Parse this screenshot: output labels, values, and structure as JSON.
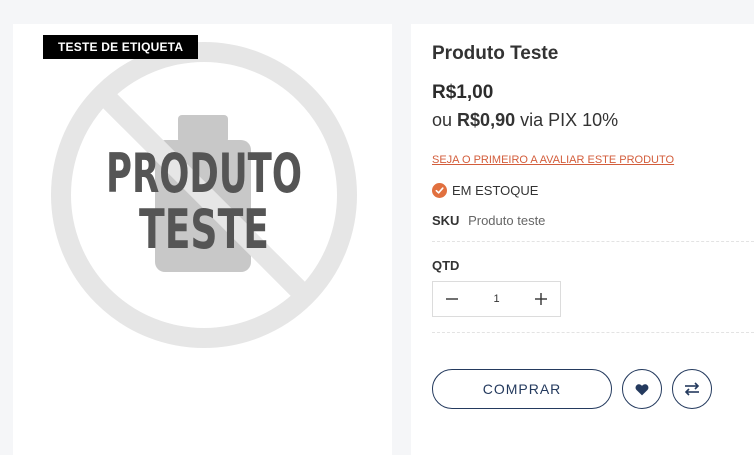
{
  "badge": {
    "label": "TESTE DE ETIQUETA"
  },
  "image": {
    "line1": "PRODUTO",
    "line2": "TESTE"
  },
  "product": {
    "title": "Produto Teste",
    "price": "R$1,00",
    "pix_prefix": "ou",
    "pix_price": "R$0,90",
    "pix_suffix": "via PIX 10%",
    "review_link": "SEJA O PRIMEIRO A AVALIAR ESTE PRODUTO",
    "stock": "EM ESTOQUE",
    "sku_label": "SKU",
    "sku_value": "Produto teste"
  },
  "quantity": {
    "label": "QTD",
    "value": "1"
  },
  "actions": {
    "buy_label": "COMPRAR"
  },
  "colors": {
    "accent": "#243a5e",
    "link": "#d35d3b",
    "stock_check": "#e1703f",
    "badge_bg": "#000000"
  },
  "icons": {
    "stock": "check-circle-icon",
    "minus": "minus-icon",
    "plus": "plus-icon",
    "wishlist": "heart-icon",
    "compare": "compare-arrows-icon"
  }
}
